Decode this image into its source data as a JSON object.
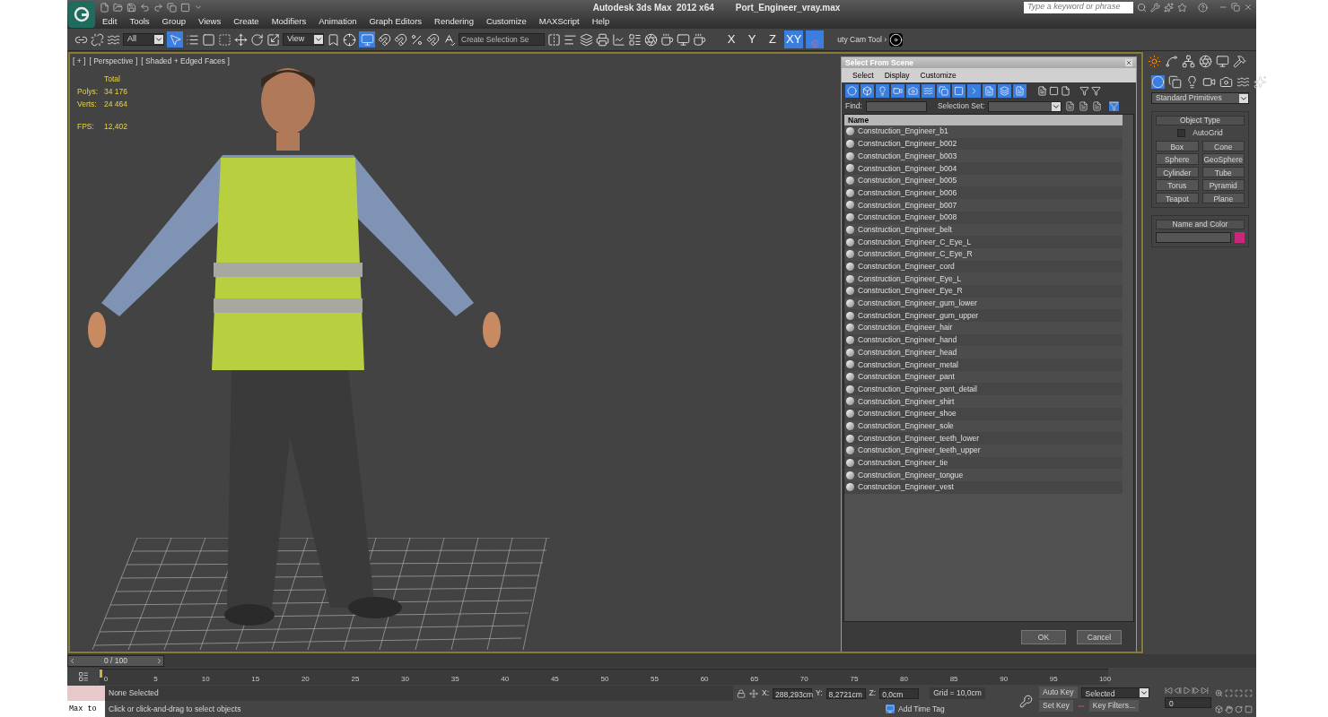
{
  "title_bar": {
    "app_title": "Autodesk 3ds Max  2012 x64",
    "file_name": "Port_Engineer_vray.max",
    "search": {
      "placeholder": "Type a keyword or phrase"
    }
  },
  "menu": [
    "Edit",
    "Tools",
    "Group",
    "Views",
    "Create",
    "Modifiers",
    "Animation",
    "Graph Editors",
    "Rendering",
    "Customize",
    "MAXScript",
    "Help"
  ],
  "toolbar": {
    "selection_filter": "All",
    "reference_coord": "View",
    "selection_set": {
      "placeholder": "Create Selection Se"
    },
    "camera_tool": "uty Cam Tool ›",
    "axes": [
      {
        "label": "X",
        "selected": false
      },
      {
        "label": "Y",
        "selected": false
      },
      {
        "label": "Z",
        "selected": false
      },
      {
        "label": "XY",
        "selected": true
      }
    ]
  },
  "viewport": {
    "labels": [
      "[ + ]",
      "[ Perspective ]",
      "[ Shaded + Edged Faces ]"
    ],
    "stats_header": "Total",
    "stats": [
      {
        "label": "Polys:",
        "value": "34 176"
      },
      {
        "label": "Verts:",
        "value": "24 464"
      },
      {
        "label": "FPS:",
        "value": "12,402"
      }
    ]
  },
  "dialog": {
    "title": "Select From Scene",
    "menu": [
      "Select",
      "Display",
      "Customize"
    ],
    "find_label": "Find:",
    "selection_set_label": "Selection Set:",
    "column": "Name",
    "items": [
      "Construction_Engineer_b1",
      "Construction_Engineer_b002",
      "Construction_Engineer_b003",
      "Construction_Engineer_b004",
      "Construction_Engineer_b005",
      "Construction_Engineer_b006",
      "Construction_Engineer_b007",
      "Construction_Engineer_b008",
      "Construction_Engineer_belt",
      "Construction_Engineer_C_Eye_L",
      "Construction_Engineer_C_Eye_R",
      "Construction_Engineer_cord",
      "Construction_Engineer_Eye_L",
      "Construction_Engineer_Eye_R",
      "Construction_Engineer_gum_lower",
      "Construction_Engineer_gum_upper",
      "Construction_Engineer_hair",
      "Construction_Engineer_hand",
      "Construction_Engineer_head",
      "Construction_Engineer_metal",
      "Construction_Engineer_pant",
      "Construction_Engineer_pant_detail",
      "Construction_Engineer_shirt",
      "Construction_Engineer_shoe",
      "Construction_Engineer_sole",
      "Construction_Engineer_teeth_lower",
      "Construction_Engineer_teeth_upper",
      "Construction_Engineer_tie",
      "Construction_Engineer_tongue",
      "Construction_Engineer_vest"
    ],
    "buttons": [
      "OK",
      "Cancel"
    ]
  },
  "command_panel": {
    "category": "Standard Primitives",
    "object_type_title": "Object Type",
    "autogrid": {
      "label": "AutoGrid",
      "checked": false
    },
    "primitives": [
      "Box",
      "Cone",
      "Sphere",
      "GeoSphere",
      "Cylinder",
      "Tube",
      "Torus",
      "Pyramid",
      "Teapot",
      "Plane"
    ],
    "name_color_title": "Name and Color"
  },
  "timeline": {
    "position": "0 / 100",
    "level": 0,
    "ticks": [
      "0",
      "5",
      "10",
      "15",
      "20",
      "25",
      "30",
      "35",
      "40",
      "45",
      "50",
      "55",
      "60",
      "65",
      "70",
      "75",
      "80",
      "85",
      "90",
      "95",
      "100"
    ]
  },
  "status": {
    "listener": "Max to",
    "selection": "None Selected",
    "prompt": "Click or click-and-drag to select objects",
    "coords": [
      {
        "label": "X:",
        "value": "288,293cm"
      },
      {
        "label": "Y:",
        "value": "8,2721cm"
      },
      {
        "label": "Z:",
        "value": "0,0cm"
      }
    ],
    "grid": "Grid = 10,0cm",
    "add_time_tag": "Add Time Tag",
    "auto_key": "Auto Key",
    "set_key": "Set Key",
    "key_mode": "Selected",
    "key_filters": "Key Filters...",
    "frame": "0"
  }
}
